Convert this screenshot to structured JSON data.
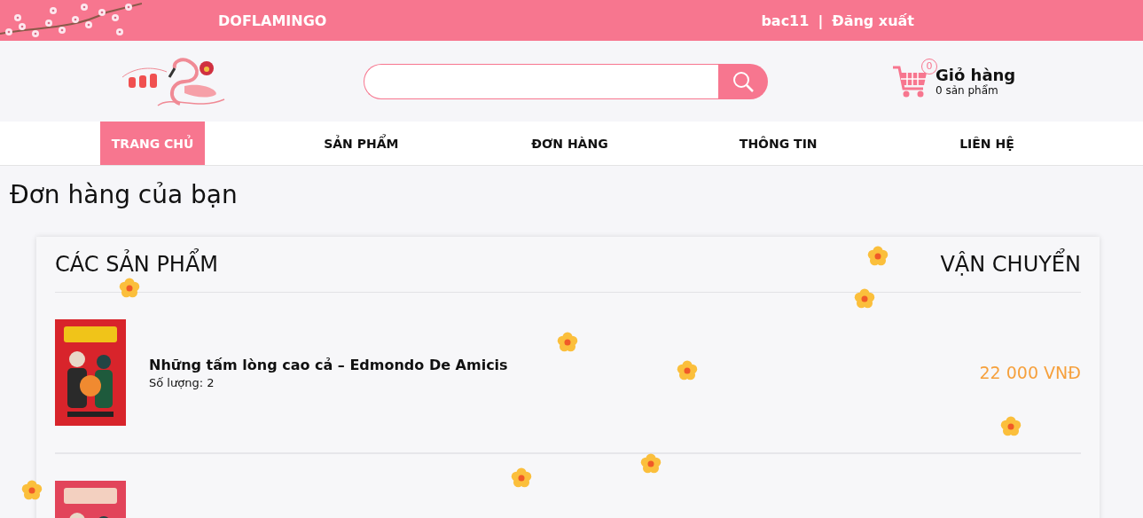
{
  "topbar": {
    "brand": "DOFLAMINGO",
    "username": "bac11",
    "separator": "|",
    "logout": "Đăng xuất"
  },
  "header": {
    "cart": {
      "count": "0",
      "title": "Giỏ hàng",
      "subtitle": "0 sản phẩm"
    }
  },
  "nav": [
    {
      "label": "TRANG CHỦ",
      "selected": true
    },
    {
      "label": "SẢN PHẨM",
      "selected": false
    },
    {
      "label": "ĐƠN HÀNG",
      "selected": false
    },
    {
      "label": "THÔNG TIN",
      "selected": false
    },
    {
      "label": "LIÊN HỆ",
      "selected": false
    }
  ],
  "page_title": "Đơn hàng của bạn",
  "orders": {
    "products_heading": "CÁC SẢN PHẨM",
    "shipping_heading": "VẬN CHUYỂN",
    "items": [
      {
        "name": "Những tấm lòng cao cả – Edmondo De Amicis",
        "quantity": "Số lượng: 2",
        "price": "22 000 VNĐ",
        "cover": {
          "kind": "picture"
        }
      },
      {
        "cover": {
          "kind": "picture"
        }
      }
    ]
  }
}
